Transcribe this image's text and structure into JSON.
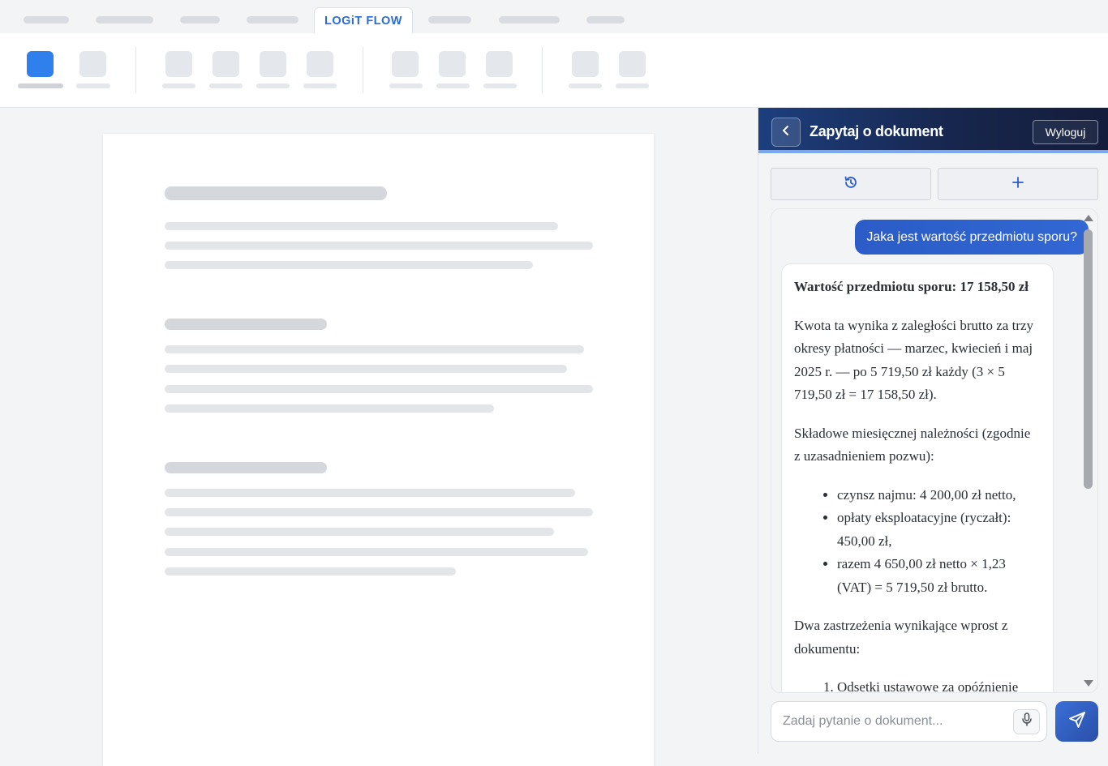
{
  "app": {
    "active_tab_label": "LOGiT FLOW"
  },
  "chat": {
    "title": "Zapytaj o dokument",
    "logout_label": "Wyloguj",
    "history_icon": "history-icon",
    "new_chat_icon": "plus-icon",
    "user_message": "Jaka jest wartość przedmiotu sporu?",
    "answer": {
      "heading": "Wartość przedmiotu sporu: 17 158,50 zł",
      "paragraph_1": "Kwota ta wynika z zaległości brutto za trzy okresy płatności — marzec, kwiecień i maj 2025 r. — po 5 719,50 zł każdy (3 × 5 719,50 zł = 17 158,50 zł).",
      "paragraph_2": "Składowe miesięcznej należności (zgodnie z uzasadnieniem pozwu):",
      "bullets": [
        "czynsz najmu: 4 200,00 zł netto,",
        "opłaty eksploatacyjne (ryczałt): 450,00 zł,",
        "razem 4 650,00 zł netto × 1,23 (VAT) = 5 719,50 zł brutto."
      ],
      "paragraph_3": "Dwa zastrzeżenia wynikające wprost z dokumentu:",
      "numbered": [
        "Odsetki ustawowe za opóźnienie"
      ]
    },
    "input_placeholder": "Zadaj pytanie o dokument...",
    "mic_icon": "microphone-icon",
    "send_icon": "send-icon"
  },
  "colors": {
    "accent": "#2f80ed",
    "header_dark": "#141d3b",
    "header_blue": "#1d3f7e",
    "user_bubble": "#2b5cc7"
  }
}
